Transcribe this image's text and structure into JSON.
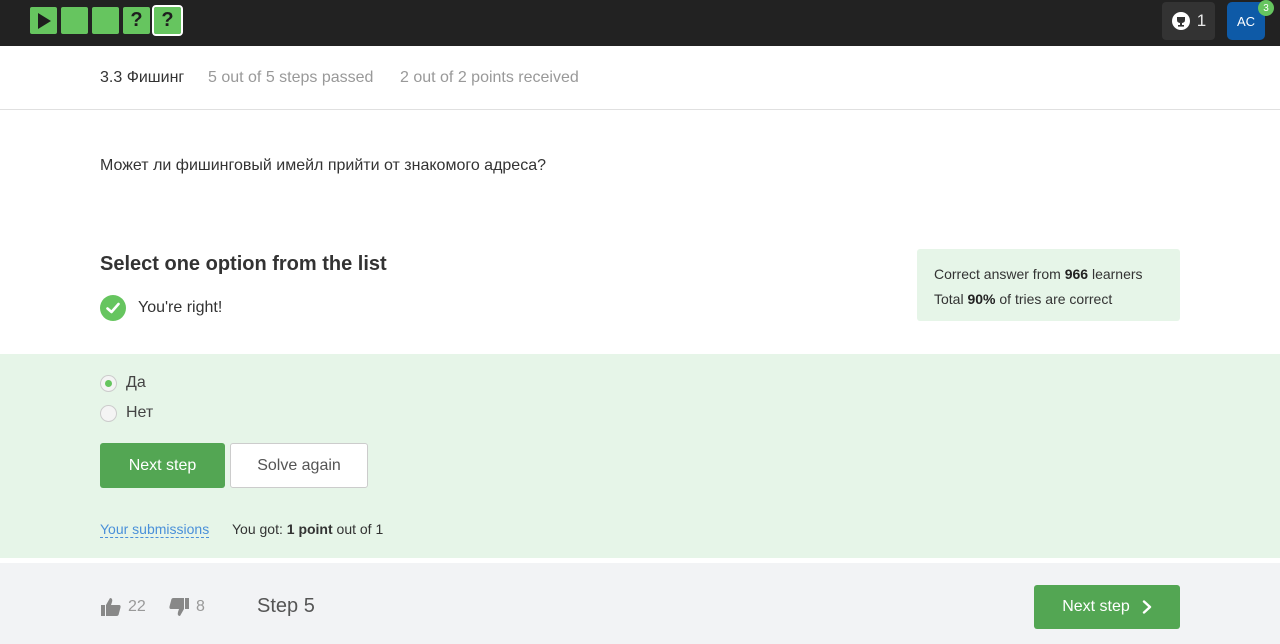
{
  "topbar": {
    "step_tiles": [
      {
        "icon": "play-icon",
        "label": ""
      },
      {
        "icon": "",
        "label": ""
      },
      {
        "icon": "",
        "label": ""
      },
      {
        "icon": "",
        "label": "?"
      },
      {
        "icon": "",
        "label": "?"
      }
    ],
    "achievements_count": "1",
    "avatar_initials": "AC",
    "notifications_count": "3",
    "colors": {
      "bar": "#222222",
      "tile": "#66c55f",
      "avatar": "#0e5aa7"
    }
  },
  "lesson": {
    "title": "3.3 Фишинг",
    "steps_passed": "5 out of 5 steps passed",
    "points_received": "2 out of 2 points  received"
  },
  "question": "Может ли фишинговый имейл прийти от знакомого адреса?",
  "quiz": {
    "instruction": "Select one option from the list",
    "feedback": "You're right!",
    "stats": {
      "line1_prefix": "Correct answer from ",
      "learners_count": "966",
      "line1_suffix": " learners",
      "line2_prefix": "Total ",
      "percent_correct": "90%",
      "line2_suffix": " of tries are correct"
    },
    "options": [
      {
        "label": "Да",
        "selected": true
      },
      {
        "label": "Нет",
        "selected": false
      }
    ],
    "next_step_label": "Next step",
    "solve_again_label": "Solve again",
    "submissions_link": "Your submissions",
    "result_prefix": "You got: ",
    "result_points": "1 point",
    "result_suffix": " out of 1"
  },
  "footer": {
    "likes": "22",
    "dislikes": "8",
    "step_label": "Step 5",
    "next_step_label": "Next step"
  }
}
